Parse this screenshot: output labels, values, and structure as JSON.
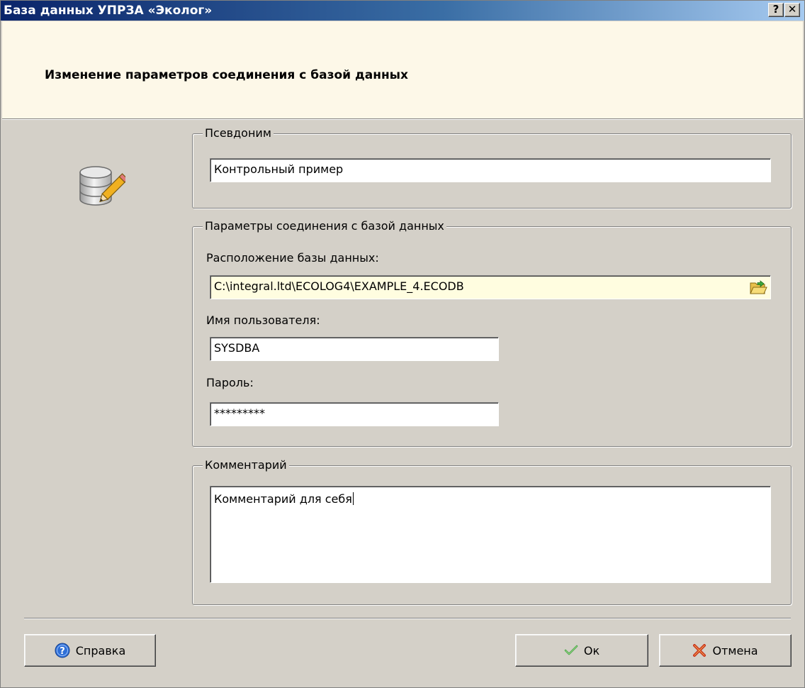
{
  "window": {
    "title": "База данных УПРЗА «Эколог»",
    "help_glyph": "?",
    "close_glyph": "✕"
  },
  "header": {
    "title": "Изменение параметров соединения с базой данных"
  },
  "icons": {
    "database": "database-edit-icon",
    "browse": "folder-open-icon",
    "help": "help-icon",
    "ok": "checkmark-icon",
    "cancel": "cross-icon"
  },
  "alias_group": {
    "legend": "Псевдоним",
    "value": "Контрольный пример"
  },
  "connection_group": {
    "legend": "Параметры соединения с базой данных",
    "location_label": "Расположение базы данных:",
    "location_value": "C:\\integral.ltd\\ECOLOG4\\EXAMPLE_4.ECODB",
    "user_label": "Имя пользователя:",
    "user_value": "SYSDBA",
    "password_label": "Пароль:",
    "password_value": "*********"
  },
  "comment_group": {
    "legend": "Комментарий",
    "value": "Комментарий для себя"
  },
  "buttons": {
    "help": "Справка",
    "ok": "Ок",
    "cancel": "Отмена"
  },
  "colors": {
    "dialog_bg": "#d4d0c8",
    "header_bg": "#fdf8e8",
    "location_bg": "#fffde0",
    "title_gradient_start": "#0a246a"
  }
}
